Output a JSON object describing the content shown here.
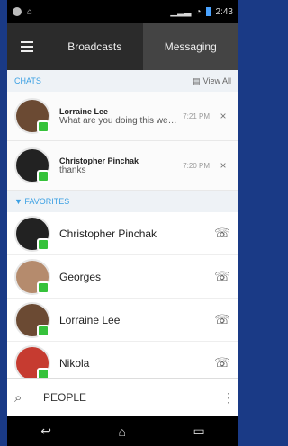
{
  "status_bar": {
    "time": "2:43"
  },
  "tabs": {
    "items": [
      {
        "label": "Broadcasts",
        "active": false
      },
      {
        "label": "Messaging",
        "active": true
      }
    ]
  },
  "chats_section": {
    "title": "CHATS",
    "view_all": "View All"
  },
  "chats": [
    {
      "name": "Lorraine Lee",
      "message": "What are you doing this weeke...",
      "time": "7:21 PM"
    },
    {
      "name": "Christopher Pinchak",
      "message": "thanks",
      "time": "7:20 PM"
    }
  ],
  "favorites_section": {
    "title": "FAVORITES"
  },
  "favorites": [
    {
      "name": "Christopher Pinchak"
    },
    {
      "name": "Georges"
    },
    {
      "name": "Lorraine Lee"
    },
    {
      "name": "Nikola"
    }
  ],
  "people": {
    "label": "PEOPLE"
  }
}
